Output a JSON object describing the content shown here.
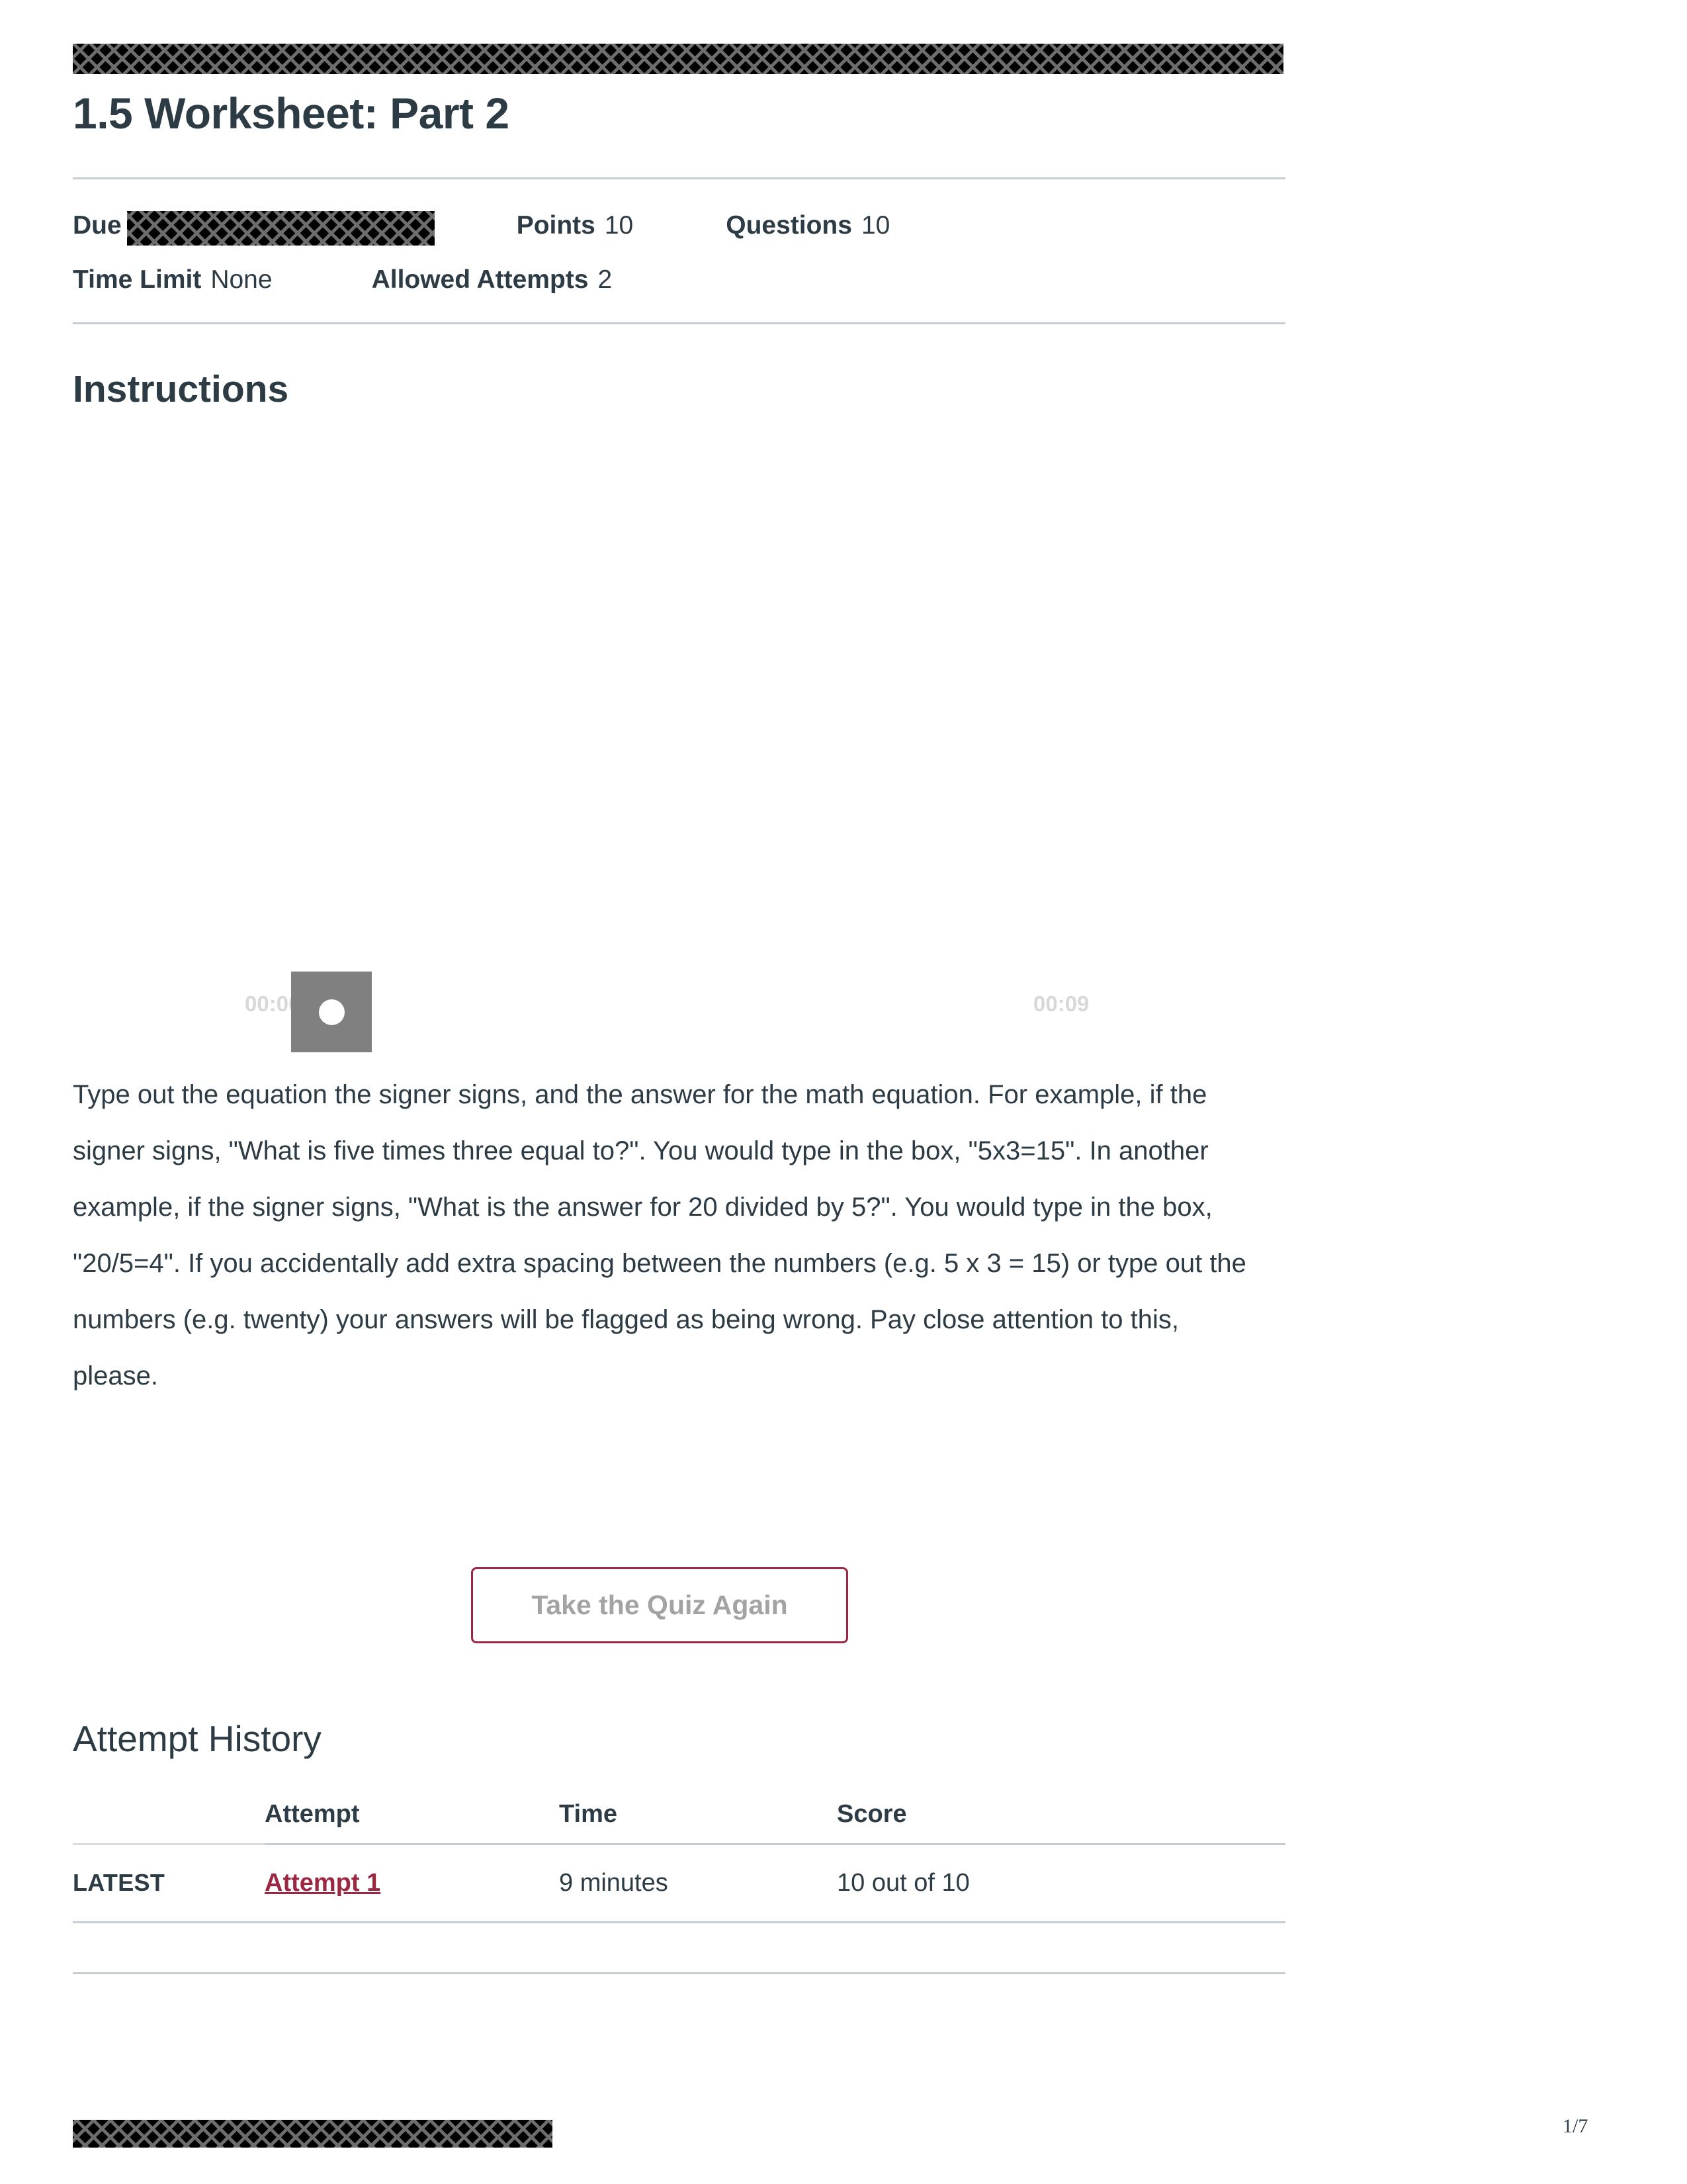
{
  "document": {
    "title": "1.5 Worksheet: Part 2",
    "page_number": "1/7"
  },
  "redactions": {
    "header_bar": "redacted-header",
    "due_value": "redacted-due-date",
    "footer_bar": "redacted-footer"
  },
  "meta": {
    "due_label": "Due",
    "points_label": "Points",
    "points_value": "10",
    "questions_label": "Questions",
    "questions_value": "10",
    "time_limit_label": "Time Limit",
    "time_limit_value": "None",
    "allowed_attempts_label": "Allowed Attempts",
    "allowed_attempts_value": "2"
  },
  "instructions": {
    "heading": "Instructions",
    "body": "Type out the equation the signer signs, and the answer for the math equation.  For example, if the signer signs, \"What is five times three equal to?\".  You would type in the box, \"5x3=15\".  In another example, if the signer signs, \"What is the answer for 20 divided by 5?\".  You would type in the box, \"20/5=4\". If you accidentally add extra spacing between the numbers (e.g. 5 x 3 = 15) or type out the numbers (e.g. twenty) your answers will be flagged as being wrong.  Pay close attention to this, please."
  },
  "video_player": {
    "current_time": "00:00",
    "duration": "00:09"
  },
  "actions": {
    "take_quiz_again": "Take the Quiz Again"
  },
  "attempt_history": {
    "heading": "Attempt History",
    "columns": [
      "",
      "Attempt",
      "Time",
      "Score"
    ],
    "rows": [
      {
        "kept": "LATEST",
        "attempt": "Attempt 1",
        "time": "9 minutes",
        "score": "10 out of 10"
      }
    ]
  },
  "colors": {
    "brand_maroon": "#9b2743",
    "text": "#2d3b45",
    "rule": "#c7cdd1",
    "muted": "#a3a3a3",
    "player_gray": "#808080",
    "timestamp_gray": "#d8d8d8"
  }
}
